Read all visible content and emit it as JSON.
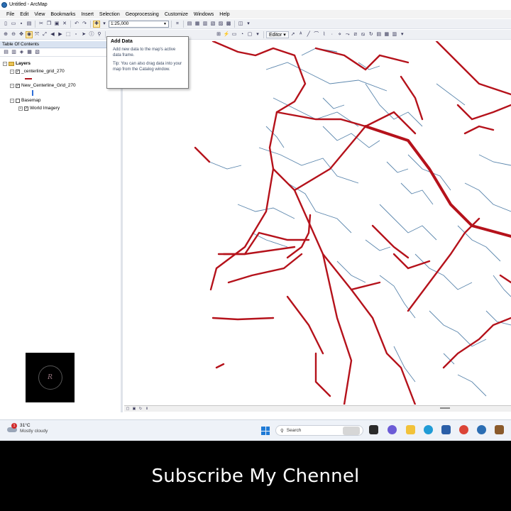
{
  "window": {
    "title": "Untitled - ArcMap"
  },
  "menu": {
    "items": [
      "File",
      "Edit",
      "View",
      "Bookmarks",
      "Insert",
      "Selection",
      "Geoprocessing",
      "Customize",
      "Windows",
      "Help"
    ]
  },
  "toolbar": {
    "scale_value": "1:25,000",
    "editor_label": "Editor ▾"
  },
  "tooltip": {
    "title": "Add Data",
    "description": "Add new data to the map's active data frame.",
    "tip": "Tip: You can also drag data into your map from the Catalog window."
  },
  "toc": {
    "title": "Table Of Contents",
    "layers_label": "Layers",
    "layer1": "_centerline_grid_270",
    "layer2": "New_Centerline_Grid_270",
    "basemap": "Basemap",
    "imagery": "World Imagery"
  },
  "taskbar": {
    "temperature": "31°C",
    "weather": "Mostly cloudy",
    "weather_badge": "1",
    "search_placeholder": "Search"
  },
  "caption": {
    "text": "Subscribe My Chennel"
  },
  "colors": {
    "road_red": "#b5121b",
    "road_blue": "#5b86ad",
    "caption_bg": "#000000"
  }
}
